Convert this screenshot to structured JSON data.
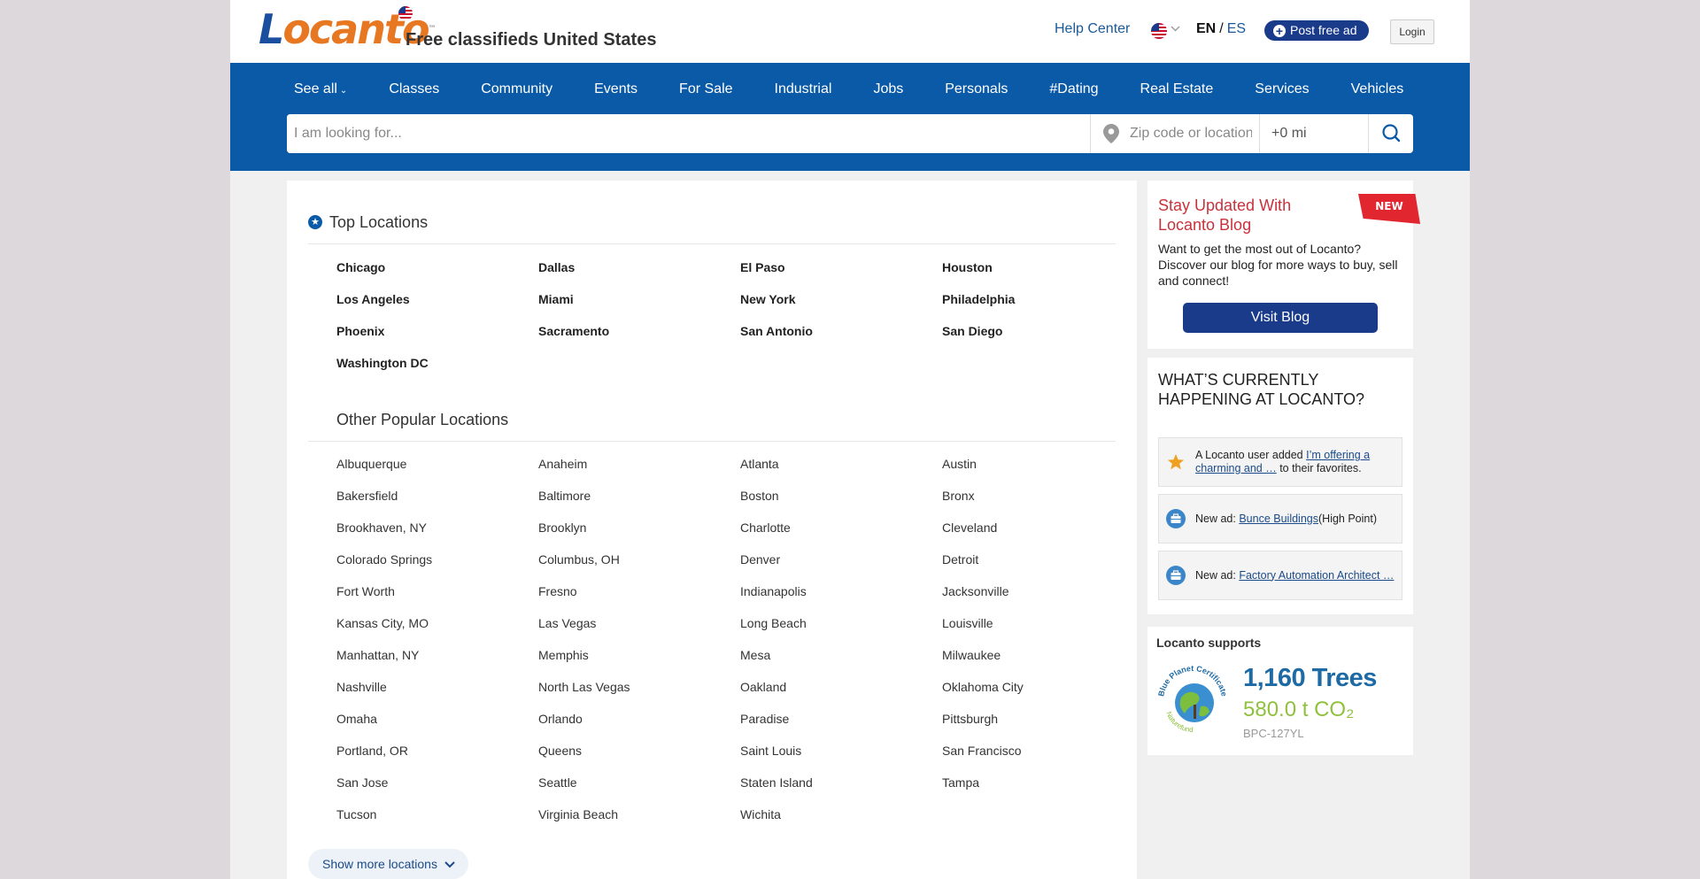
{
  "header": {
    "logo_text": "Locanto",
    "logo_tm": "™",
    "site_title": "Free classifieds United States",
    "help_center": "Help Center",
    "lang_en": "EN",
    "lang_sep": "/",
    "lang_es": "ES",
    "post_ad": "Post free ad",
    "login": "Login"
  },
  "nav": {
    "items": [
      "See all",
      "Classes",
      "Community",
      "Events",
      "For Sale",
      "Industrial",
      "Jobs",
      "Personals",
      "#Dating",
      "Real Estate",
      "Services",
      "Vehicles"
    ]
  },
  "search": {
    "query_placeholder": "I am looking for...",
    "location_placeholder": "Zip code or location",
    "radius": "+0 mi"
  },
  "top_locations": {
    "title": "Top Locations",
    "cities": [
      "Chicago",
      "Dallas",
      "El Paso",
      "Houston",
      "Los Angeles",
      "Miami",
      "New York",
      "Philadelphia",
      "Phoenix",
      "Sacramento",
      "San Antonio",
      "San Diego",
      "Washington DC"
    ]
  },
  "other_locations": {
    "title": "Other Popular Locations",
    "cities": [
      "Albuquerque",
      "Anaheim",
      "Atlanta",
      "Austin",
      "Bakersfield",
      "Baltimore",
      "Boston",
      "Bronx",
      "Brookhaven, NY",
      "Brooklyn",
      "Charlotte",
      "Cleveland",
      "Colorado Springs",
      "Columbus, OH",
      "Denver",
      "Detroit",
      "Fort Worth",
      "Fresno",
      "Indianapolis",
      "Jacksonville",
      "Kansas City, MO",
      "Las Vegas",
      "Long Beach",
      "Louisville",
      "Manhattan, NY",
      "Memphis",
      "Mesa",
      "Milwaukee",
      "Nashville",
      "North Las Vegas",
      "Oakland",
      "Oklahoma City",
      "Omaha",
      "Orlando",
      "Paradise",
      "Pittsburgh",
      "Portland, OR",
      "Queens",
      "Saint Louis",
      "San Francisco",
      "San Jose",
      "Seattle",
      "Staten Island",
      "Tampa",
      "Tucson",
      "Virginia Beach",
      "Wichita"
    ],
    "show_more": "Show more locations"
  },
  "blog": {
    "title": "Stay Updated With Locanto Blog",
    "ribbon": "NEW",
    "text": "Want to get the most out of Locanto? Discover our blog for more ways to buy, sell and connect!",
    "button": "Visit Blog"
  },
  "happening": {
    "title": "WHAT’S CURRENTLY HAPPENING AT LOCANTO?",
    "items": [
      {
        "icon": "star-icon",
        "prefix": "A Locanto user added ",
        "link": "I’m offering a charming and …",
        "suffix": " to their favorites."
      },
      {
        "icon": "briefcase-icon",
        "prefix": "New ad: ",
        "link": "Bunce Buildings",
        "suffix": "(High Point)"
      },
      {
        "icon": "briefcase-icon",
        "prefix": "New ad: ",
        "link": "Factory Automation Architect …",
        "suffix": ""
      }
    ]
  },
  "supports": {
    "title": "Locanto supports",
    "badge_text": "Blue Planet Certificate",
    "badge_sub": "Naturefund",
    "trees": "1,160 Trees",
    "co2": "580.0 t CO₂",
    "code": "BPC-127YL"
  },
  "colors": {
    "brand_blue": "#0a5aa8",
    "dark_blue": "#1a3a8a",
    "logo_orange": "#e87722",
    "blog_red": "#c8323c"
  }
}
